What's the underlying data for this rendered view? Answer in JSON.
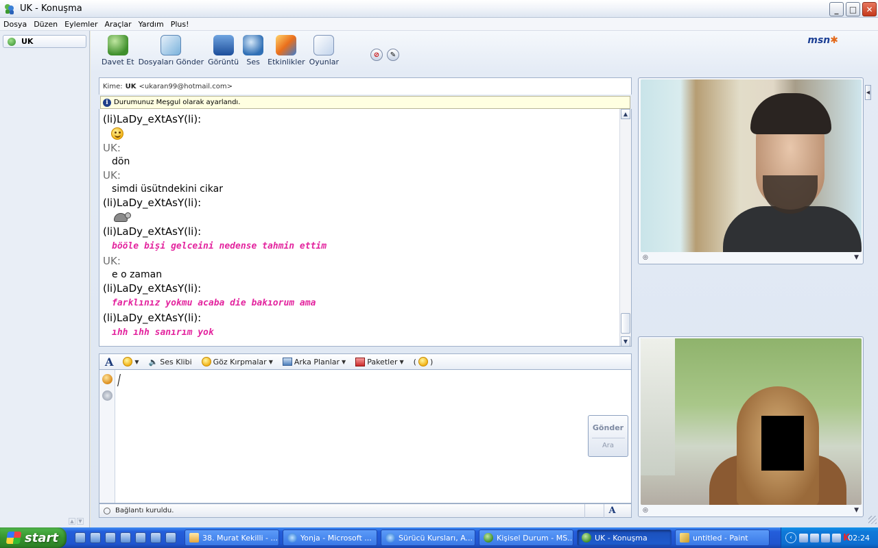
{
  "window": {
    "title": "UK - Konuşma",
    "buttons": {
      "minimize": "_",
      "maximize": "□",
      "close": "✕"
    }
  },
  "menu": [
    "Dosya",
    "Düzen",
    "Eylemler",
    "Araçlar",
    "Yardım",
    "Plus!"
  ],
  "sidebar": {
    "contact": "UK"
  },
  "toolbar": {
    "buttons": [
      "Davet Et",
      "Dosyaları Gönder",
      "Görüntü",
      "Ses",
      "Etkinlikler",
      "Oyunlar"
    ],
    "logo": "msn"
  },
  "to_bar": {
    "label": "Kime:",
    "name": "UK",
    "email": "<ukaran99@hotmail.com>"
  },
  "notice": "Durumunuz Meşgul olarak ayarlandı.",
  "conversation": [
    {
      "sender": "(li)LaDy_eXtAsY(li):",
      "kind": "emoticon",
      "emoticon": "smiley"
    },
    {
      "sender": "UK:",
      "kind": "text",
      "text": "dön"
    },
    {
      "sender": "UK:",
      "kind": "text",
      "text": "simdi üsütndekini cikar"
    },
    {
      "sender": "(li)LaDy_eXtAsY(li):",
      "kind": "emoticon",
      "emoticon": "turtle"
    },
    {
      "sender": "(li)LaDy_eXtAsY(li):",
      "kind": "styled",
      "text": "bööle bişi gelceini nedense tahmin ettim"
    },
    {
      "sender": "UK:",
      "kind": "text",
      "text": "e o zaman"
    },
    {
      "sender": "(li)LaDy_eXtAsY(li):",
      "kind": "styled",
      "text": "farklınız yokmu acaba die bakıorum ama"
    },
    {
      "sender": "(li)LaDy_eXtAsY(li):",
      "kind": "styled",
      "text": "ıhh ıhh sanırım yok"
    }
  ],
  "format_bar": {
    "font": "A",
    "sound_clip": "Ses Klibi",
    "winks": "Göz Kırpmalar",
    "backgrounds": "Arka Planlar",
    "packs": "Paketler"
  },
  "send": {
    "send_label": "Gönder",
    "search_label": "Ara"
  },
  "status": {
    "text": "Bağlantı kuruldu.",
    "font_btn": "A"
  },
  "taskbar": {
    "start": "start",
    "tasks": [
      {
        "label": "38. Murat Kekilli - ...",
        "icon": "folder"
      },
      {
        "label": "Yonja - Microsoft ...",
        "icon": "ie"
      },
      {
        "label": "Sürücü Kursları, A...",
        "icon": "ie"
      },
      {
        "label": "Kişisel Durum - MS...",
        "icon": "msn"
      },
      {
        "label": "UK - Konuşma",
        "icon": "msn",
        "active": true
      },
      {
        "label": "untitled - Paint",
        "icon": "paint"
      }
    ],
    "clock": "02:24"
  },
  "colors": {
    "styled_text": "#e3249e",
    "accent": "#245edb"
  }
}
